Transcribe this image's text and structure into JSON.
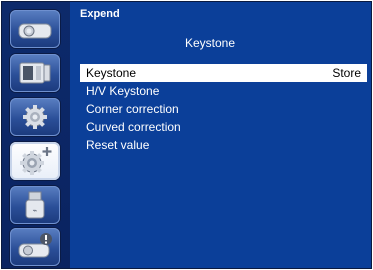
{
  "panel": {
    "title": "Expend",
    "subtitle": "Keystone"
  },
  "menu": {
    "items": [
      {
        "label": "Keystone",
        "value": "Store",
        "selected": true
      },
      {
        "label": "H/V Keystone"
      },
      {
        "label": "Corner correction"
      },
      {
        "label": "Curved correction"
      },
      {
        "label": "Reset value"
      }
    ]
  },
  "sidebar": {
    "icons": [
      "projector-icon",
      "display-input-icon",
      "settings-gear-icon",
      "expand-settings-icon",
      "usb-icon",
      "info-projector-icon"
    ],
    "active_index": 3
  },
  "colors": {
    "panel": "#0b3f99",
    "sidebar": "#0d2a6b",
    "selection": "#ffffff"
  }
}
